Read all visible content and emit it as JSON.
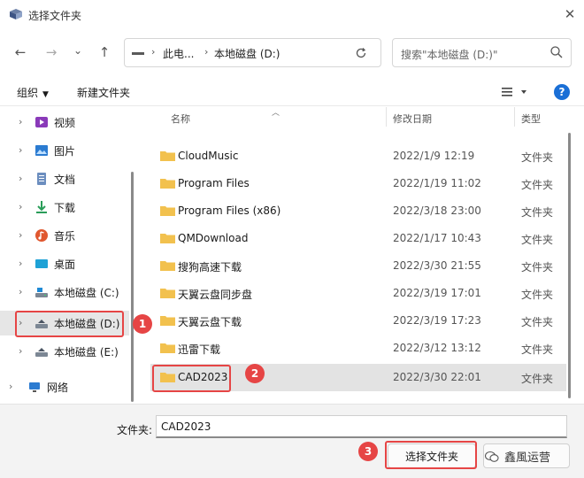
{
  "window": {
    "title": "选择文件夹"
  },
  "nav": {
    "back_glyph": "←",
    "forward_glyph": "→",
    "recent_glyph": "⌄",
    "up_glyph": "↑"
  },
  "address": {
    "crumbs": [
      "此电...",
      "本地磁盘 (D:)"
    ],
    "separator": "›"
  },
  "search": {
    "placeholder": "搜索\"本地磁盘 (D:)\""
  },
  "toolbar": {
    "organize_label": "组织",
    "new_folder_label": "新建文件夹",
    "help_label": "?"
  },
  "sidebar": {
    "items": [
      {
        "label": "视频",
        "icon": "video-icon"
      },
      {
        "label": "图片",
        "icon": "pictures-icon"
      },
      {
        "label": "文档",
        "icon": "documents-icon"
      },
      {
        "label": "下载",
        "icon": "download-icon"
      },
      {
        "label": "音乐",
        "icon": "music-icon"
      },
      {
        "label": "桌面",
        "icon": "desktop-icon"
      },
      {
        "label": "本地磁盘 (C:)",
        "icon": "drive-icon"
      },
      {
        "label": "本地磁盘 (D:)",
        "icon": "drive-icon",
        "selected": true
      },
      {
        "label": "本地磁盘 (E:)",
        "icon": "drive-icon"
      },
      {
        "label": "网络",
        "icon": "network-icon"
      }
    ]
  },
  "columns": {
    "name": "名称",
    "date": "修改日期",
    "type": "类型"
  },
  "files": [
    {
      "name": "CloudMusic",
      "date": "2022/1/9 12:19",
      "type": "文件夹"
    },
    {
      "name": "Program Files",
      "date": "2022/1/19 11:02",
      "type": "文件夹"
    },
    {
      "name": "Program Files (x86)",
      "date": "2022/3/18 23:00",
      "type": "文件夹"
    },
    {
      "name": "QMDownload",
      "date": "2022/1/17 10:43",
      "type": "文件夹"
    },
    {
      "name": "搜狗高速下载",
      "date": "2022/3/30 21:55",
      "type": "文件夹"
    },
    {
      "name": "天翼云盘同步盘",
      "date": "2022/3/19 17:01",
      "type": "文件夹"
    },
    {
      "name": "天翼云盘下载",
      "date": "2022/3/19 17:23",
      "type": "文件夹"
    },
    {
      "name": "迅雷下载",
      "date": "2022/3/12 13:12",
      "type": "文件夹"
    },
    {
      "name": "CAD2023",
      "date": "2022/3/30 22:01",
      "type": "文件夹",
      "selected": true
    }
  ],
  "bottom": {
    "filename_label": "文件夹:",
    "filename_value": "CAD2023",
    "select_button": "选择文件夹",
    "watermark": "鑫風运营"
  },
  "callouts": [
    "1",
    "2",
    "3"
  ],
  "colors": {
    "accent": "#1a6fd6",
    "highlight": "#e64545",
    "folder": "#f2c14e"
  }
}
